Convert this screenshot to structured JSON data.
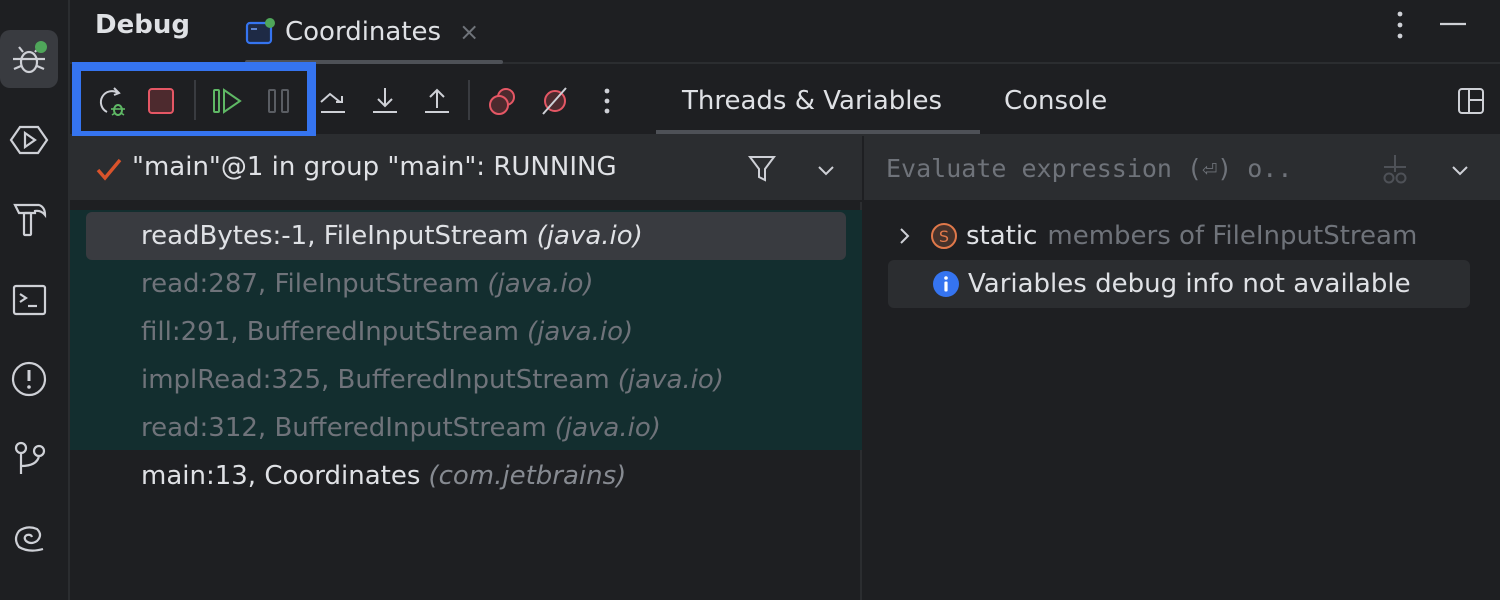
{
  "header": {
    "title": "Debug",
    "tab": {
      "label": "Coordinates",
      "close": "×"
    }
  },
  "sidebar": {
    "items": [
      {
        "name": "debug",
        "active": true,
        "badge": "running"
      },
      {
        "name": "run"
      },
      {
        "name": "build"
      },
      {
        "name": "terminal"
      },
      {
        "name": "problems"
      },
      {
        "name": "git"
      },
      {
        "name": "spiral"
      }
    ]
  },
  "toolbar": {
    "actions": [
      "rerun",
      "stop",
      "resume",
      "pause",
      "step-over",
      "step-into",
      "step-out",
      "view-breakpoints",
      "mute-breakpoints",
      "more"
    ],
    "view_tabs": [
      {
        "label": "Threads & Variables",
        "active": true
      },
      {
        "label": "Console",
        "active": false
      }
    ]
  },
  "threads": {
    "selected_thread": "\"main\"@1 in group \"main\": RUNNING",
    "frames": [
      {
        "method": "readBytes:-1, FileInputStream",
        "package": "(java.io)",
        "state": "selected"
      },
      {
        "method": "read:287, FileInputStream",
        "package": "(java.io)",
        "state": "dim"
      },
      {
        "method": "fill:291, BufferedInputStream",
        "package": "(java.io)",
        "state": "dim"
      },
      {
        "method": "implRead:325, BufferedInputStream",
        "package": "(java.io)",
        "state": "dim"
      },
      {
        "method": "read:312, BufferedInputStream",
        "package": "(java.io)",
        "state": "dim"
      },
      {
        "method": "main:13, Coordinates",
        "package": "(com.jetbrains)",
        "state": "normal"
      }
    ]
  },
  "variables": {
    "eval_placeholder": "Evaluate expression (⏎) o..",
    "eval_value": "",
    "rows": [
      {
        "keyword": "static",
        "text": "members of FileInputStream",
        "icon": "S"
      },
      {
        "text": "Variables debug info not available",
        "icon": "i"
      }
    ]
  },
  "colors": {
    "accent": "#3574f0",
    "stop_red": "#e55765",
    "resume_green": "#5fb865",
    "frames_bg": "#132e2f",
    "check_orange": "#d9532b"
  }
}
